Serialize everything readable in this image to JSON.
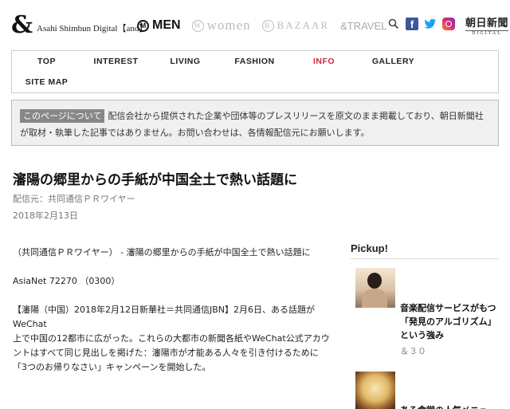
{
  "header": {
    "logo": "&",
    "brand_text": "Asahi Shimbun Digital【and】",
    "brands": [
      {
        "mark": "M",
        "label": "MEN"
      },
      {
        "mark": "W",
        "label": "women"
      },
      {
        "mark": "B",
        "label": "BAZAAR"
      },
      {
        "mark": "",
        "label": "&TRAVEL"
      }
    ],
    "icons": [
      "search-icon",
      "facebook-icon",
      "twitter-icon",
      "instagram-icon"
    ],
    "asahi_jp": "朝日新聞",
    "asahi_digital": "DIGITAL"
  },
  "nav": {
    "items": [
      "TOP",
      "INTEREST",
      "LIVING",
      "FASHION",
      "INFO",
      "GALLERY"
    ],
    "sitemap": "SITE MAP",
    "active": "INFO"
  },
  "notice": {
    "label": "このページについて",
    "text": "配信会社から提供された企業や団体等のプレスリリースを原文のまま掲載しており、朝日新聞社が取材・執筆した記事ではありません。お問い合わせは、各情報配信元にお願いします。"
  },
  "article": {
    "title": "瀋陽の郷里からの手紙が中国全土で熱い話題に",
    "source": "配信元：共同通信ＰＲワイヤー",
    "date": "2018年2月13日",
    "paragraphs": [
      "（共同通信ＰＲワイヤー） - 瀋陽の郷里からの手紙が中国全土で熱い話題に",
      "AsiaNet 72270 （0300）",
      "【瀋陽（中国）2018年2月12日新華社＝共同通信JBN】2月6日、ある話題がWeChat",
      "上で中国の12都市に広がった。これらの大都市の新聞各紙やWeChat公式アカウントはすべて同じ見出しを掲げた：瀋陽市が才能ある人々を引き付けるために「3つのお帰りなさい」キャンペーンを開始した。"
    ]
  },
  "pickup": {
    "heading": "Pickup!",
    "items": [
      {
        "title": "音楽配信サービスがもつ「発見のアルゴリズム」という強み",
        "tag": "＆３０"
      },
      {
        "title": "ある食堂の人気メニューが話題に",
        "tag": ""
      }
    ]
  },
  "colors": {
    "accent": "#d6263c",
    "facebook": "#3b5998",
    "twitter": "#1da1f2"
  }
}
